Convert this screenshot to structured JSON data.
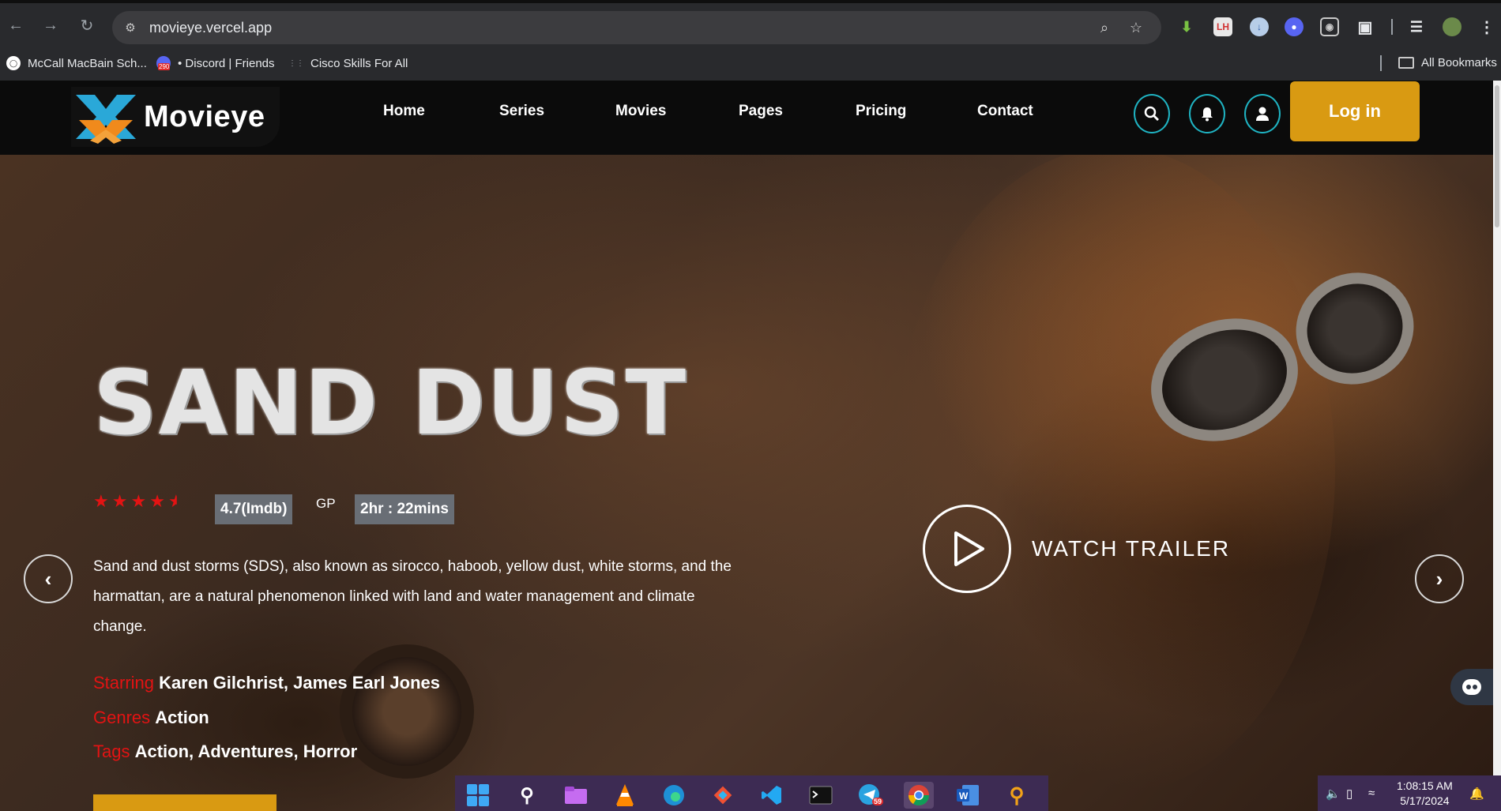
{
  "browser": {
    "url": "movieye.vercel.app",
    "bookmarks": [
      {
        "label": "McCall MacBain Sch...",
        "icon": "mccall-icon"
      },
      {
        "label": "• Discord | Friends",
        "icon": "discord-icon",
        "badge": "290"
      },
      {
        "label": "Cisco Skills For All",
        "icon": "cisco-icon"
      }
    ],
    "all_bookmarks": "All Bookmarks",
    "extension_lh": "LH"
  },
  "site": {
    "logo_text": "Movieye",
    "menu": [
      "Home",
      "Series",
      "Movies",
      "Pages",
      "Pricing",
      "Contact"
    ],
    "login_label": "Log in"
  },
  "hero": {
    "title": "SAND DUST",
    "stars": 4.5,
    "imdb": "4.7(Imdb)",
    "rating": "GP",
    "duration": "2hr : 22mins",
    "description": "Sand and dust storms (SDS), also known as sirocco, haboob, yellow dust, white storms, and the harmattan, are a natural phenomenon linked with land and water management and climate change.",
    "starring_label": "Starring",
    "starring": "Karen Gilchrist, James Earl Jones",
    "genres_label": "Genres",
    "genres": "Action",
    "tags_label": "Tags",
    "tags": "Action, Adventures, Horror",
    "watch_trailer": "WATCH TRAILER"
  },
  "taskbar": {
    "telegram_badge": "59",
    "time": "1:08:15 AM",
    "date": "5/17/2024"
  },
  "colors": {
    "accent": "#d99a12",
    "teal": "#1fb3c2",
    "label_red": "#e31313",
    "logo_blue": "#2aa8d8",
    "logo_orange": "#f08a1c"
  }
}
